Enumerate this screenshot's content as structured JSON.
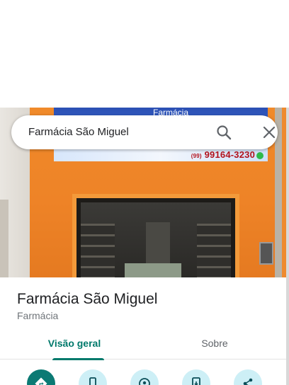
{
  "search": {
    "query": "Farmácia São Miguel"
  },
  "photo": {
    "sign_title": "Farmácia",
    "sign_phone_area": "(99)",
    "sign_phone": "99164-3230"
  },
  "place": {
    "name": "Farmácia São Miguel",
    "category": "Farmácia"
  },
  "tabs": [
    {
      "label": "Visão geral",
      "active": true
    },
    {
      "label": "Sobre",
      "active": false
    }
  ],
  "actions": [
    {
      "icon": "directions-icon"
    },
    {
      "icon": "phone-icon"
    },
    {
      "icon": "nearby-icon"
    },
    {
      "icon": "save-to-phone-icon"
    },
    {
      "icon": "share-icon"
    }
  ],
  "colors": {
    "accent": "#00796b",
    "action_primary": "#0b7a74",
    "action_secondary": "#cdeff6",
    "facade_orange": "#ee8327"
  }
}
